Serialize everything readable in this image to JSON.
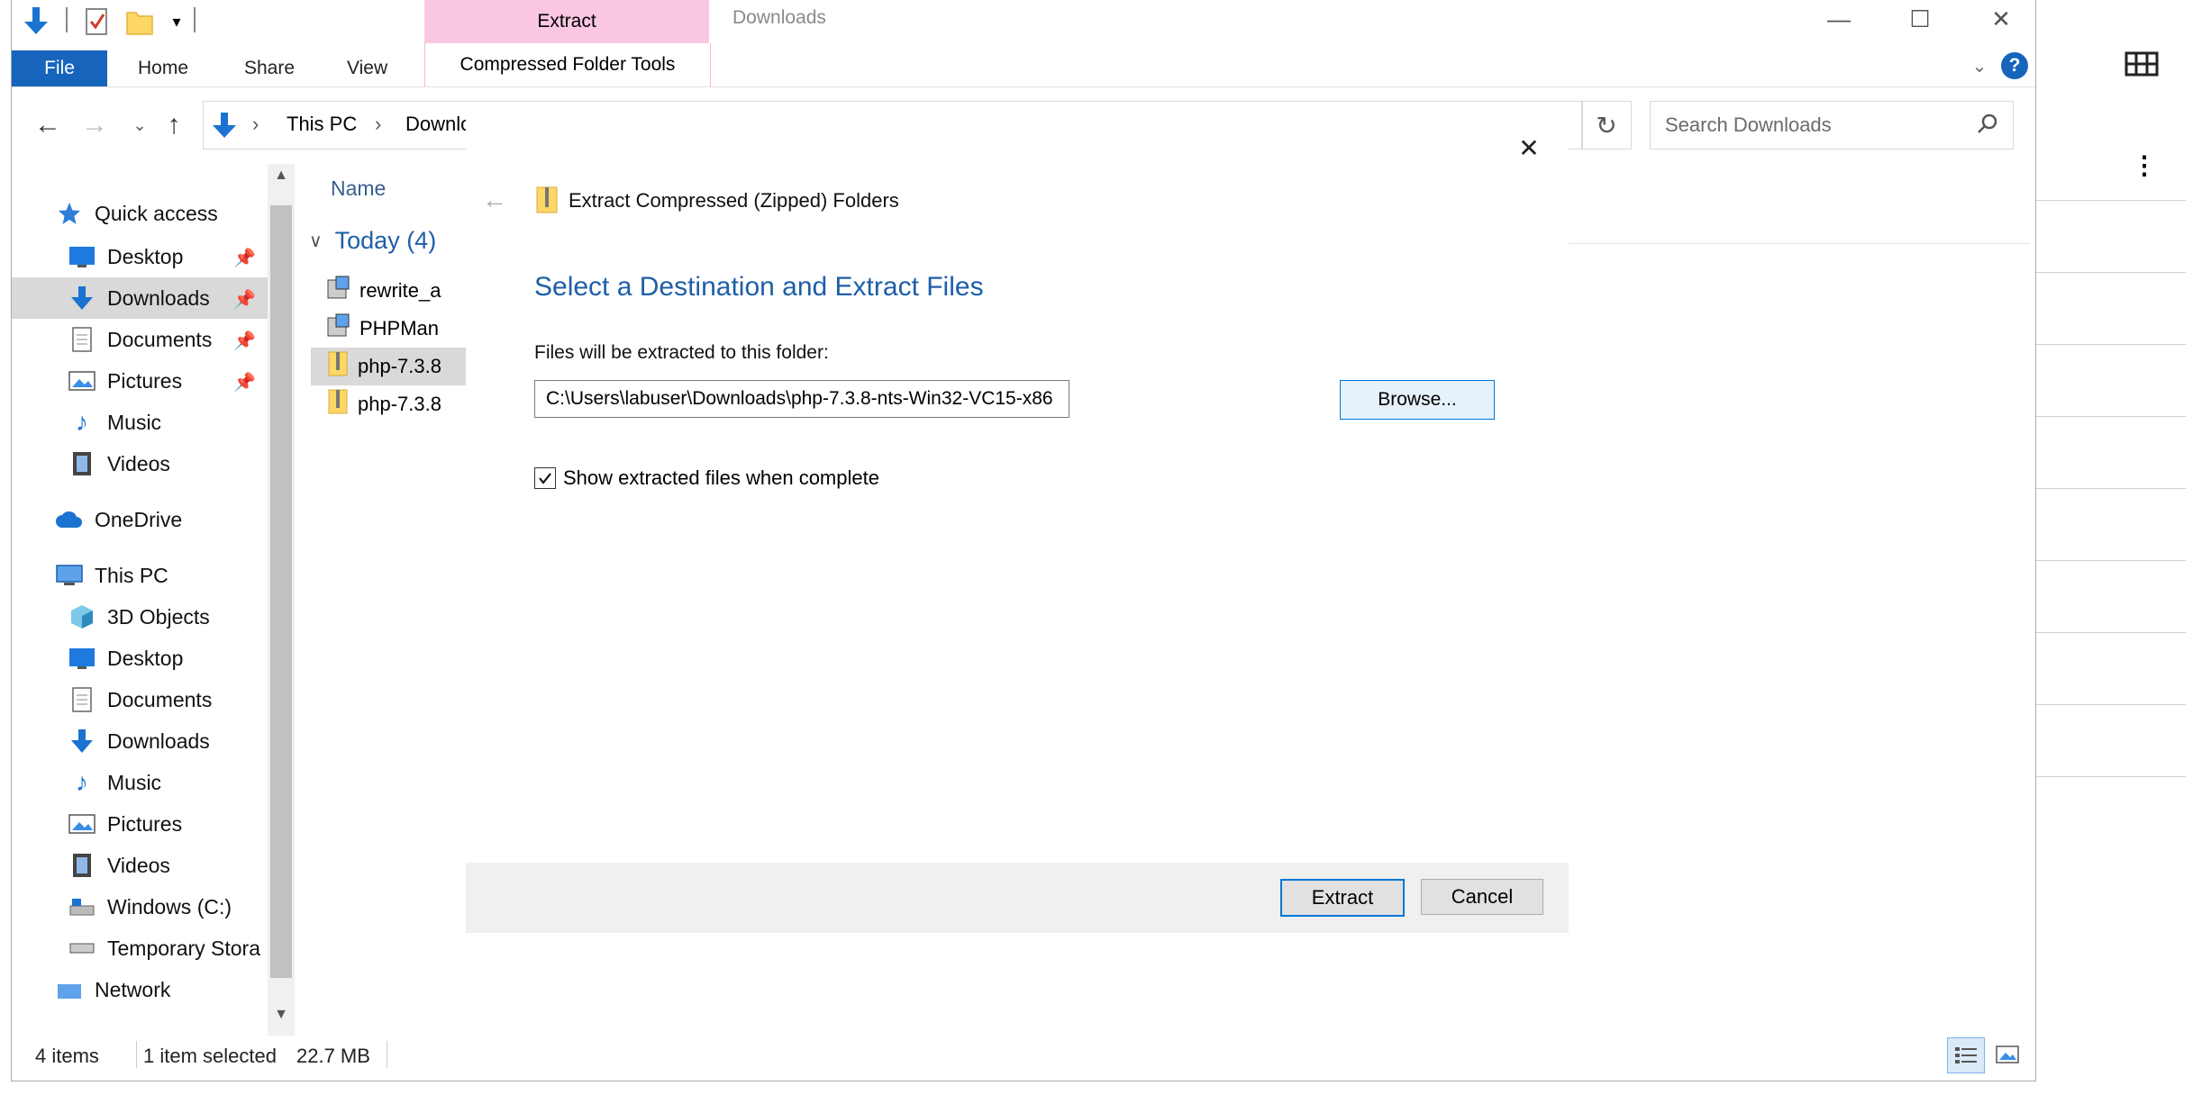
{
  "window": {
    "title": "Downloads",
    "context_tab": "Extract",
    "context_group": "Compressed Folder Tools",
    "controls": {
      "minimize": "—",
      "maximize": "☐",
      "close": "✕"
    }
  },
  "ribbon": {
    "file": "File",
    "tabs": [
      "Home",
      "Share",
      "View"
    ],
    "help": "?"
  },
  "address": {
    "crumbs": [
      "This PC",
      "Downlo"
    ],
    "separator": "›",
    "refresh": "↻",
    "search_placeholder": "Search Downloads"
  },
  "nav": {
    "quick_access": "Quick access",
    "quick_items": [
      "Desktop",
      "Downloads",
      "Documents",
      "Pictures",
      "Music",
      "Videos"
    ],
    "onedrive": "OneDrive",
    "this_pc": "This PC",
    "pc_items": [
      "3D Objects",
      "Desktop",
      "Documents",
      "Downloads",
      "Music",
      "Pictures",
      "Videos",
      "Windows (C:)",
      "Temporary Stora"
    ],
    "network": "Network"
  },
  "files": {
    "column_name": "Name",
    "group_header": "Today (4)",
    "items": [
      "rewrite_a",
      "PHPMan",
      "php-7.3.8",
      "php-7.3.8"
    ]
  },
  "status": {
    "count": "4 items",
    "selection": "1 item selected",
    "size": "22.7 MB"
  },
  "dialog": {
    "title": "Extract Compressed (Zipped) Folders",
    "heading": "Select a Destination and Extract Files",
    "label": "Files will be extracted to this folder:",
    "path": "C:\\Users\\labuser\\Downloads\\php-7.3.8-nts-Win32-VC15-x86",
    "browse": "Browse...",
    "checkbox_label": "Show extracted files when complete",
    "checkbox_checked": true,
    "extract": "Extract",
    "cancel": "Cancel",
    "close": "✕",
    "back": "←"
  },
  "colors": {
    "accent": "#1664bc",
    "heading": "#1e5ea8",
    "context_tab": "#f9c7e2"
  }
}
